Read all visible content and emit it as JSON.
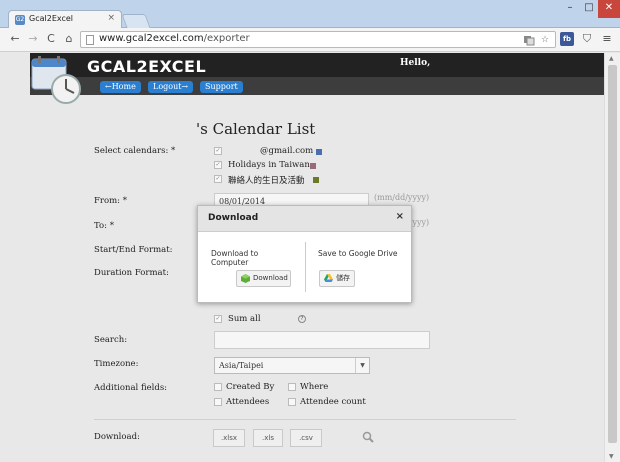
{
  "browser": {
    "tab_title": "Gcal2Excel",
    "tab_close": "×",
    "favicon_text": "G2",
    "url_host": "www.gcal2excel.com",
    "url_path": "/exporter",
    "nav_back": "←",
    "nav_forward": "→",
    "nav_reload": "C",
    "nav_home": "⌂",
    "ext_fb": "fb",
    "win_min": "–",
    "win_max": "□",
    "win_close": "✕"
  },
  "header": {
    "brand": "GCAL2EXCEL",
    "hello": "Hello,",
    "nav": [
      {
        "label": "←Home"
      },
      {
        "label": "Logout→"
      },
      {
        "label": "Support"
      }
    ],
    "colors": {
      "accent": "#2a7fd1",
      "bar": "#222222"
    }
  },
  "main": {
    "title": "'s Calendar List",
    "select_label": "Select calendars:  *",
    "calendars": [
      {
        "name": "@gmail.com",
        "color": "#4a6fb0",
        "checked": true
      },
      {
        "name": "Holidays in Taiwan",
        "color": "#9a6a7a",
        "checked": true
      },
      {
        "name": "聯絡人的生日及活動",
        "color": "#6a7a2a",
        "checked": true
      }
    ],
    "from_label": "From:  *",
    "from_value": "08/01/2014",
    "date_hint": "(mm/dd/yyyy)",
    "to_label": "To:  *",
    "to_hint": "(mm/dd/yyyy)",
    "start_end_label": "Start/End Format:",
    "duration_label": "Duration Format:",
    "sum_all_label": "Sum all",
    "help_glyph": "?",
    "search_label": "Search:",
    "search_value": "",
    "timezone_label": "Timezone:",
    "timezone_value": "Asia/Taipei",
    "additional_label": "Additional fields:",
    "fields": [
      "Created By",
      "Where",
      "Attendees",
      "Attendee count"
    ],
    "download_label": "Download:",
    "download_formats": [
      ".xlsx",
      ".xls",
      ".csv"
    ]
  },
  "modal": {
    "title": "Download",
    "close": "×",
    "left_title": "Download to Computer",
    "left_button": "Download",
    "right_title": "Save to Google Drive",
    "right_button": "儲存"
  }
}
